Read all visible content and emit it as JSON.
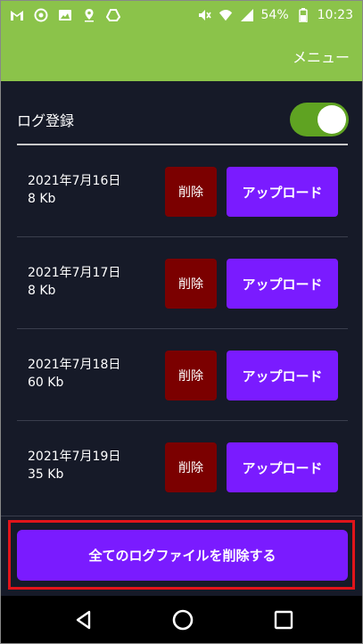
{
  "statusbar": {
    "icons_left": [
      "gmail-icon",
      "wifi-signal-app-icon",
      "image-icon",
      "location-icon",
      "drive-icon"
    ],
    "battery": "54%",
    "time": "10:23"
  },
  "appbar": {
    "menu_label": "メニュー"
  },
  "log": {
    "label": "ログ登録",
    "enabled": true
  },
  "files": [
    {
      "date": "2021年7月16日",
      "size": "8 Kb",
      "delete_label": "削除",
      "upload_label": "アップロード"
    },
    {
      "date": "2021年7月17日",
      "size": "8 Kb",
      "delete_label": "削除",
      "upload_label": "アップロード"
    },
    {
      "date": "2021年7月18日",
      "size": "60 Kb",
      "delete_label": "削除",
      "upload_label": "アップロード"
    },
    {
      "date": "2021年7月19日",
      "size": "35 Kb",
      "delete_label": "削除",
      "upload_label": "アップロード"
    }
  ],
  "delete_all_label": "全てのログファイルを削除する",
  "colors": {
    "accent_green": "#8bc34a",
    "toggle_on": "#5fa322",
    "upload_purple": "#7a1bff",
    "delete_red": "#7b0000",
    "background": "#161a28",
    "highlight_frame": "#e0141a"
  }
}
